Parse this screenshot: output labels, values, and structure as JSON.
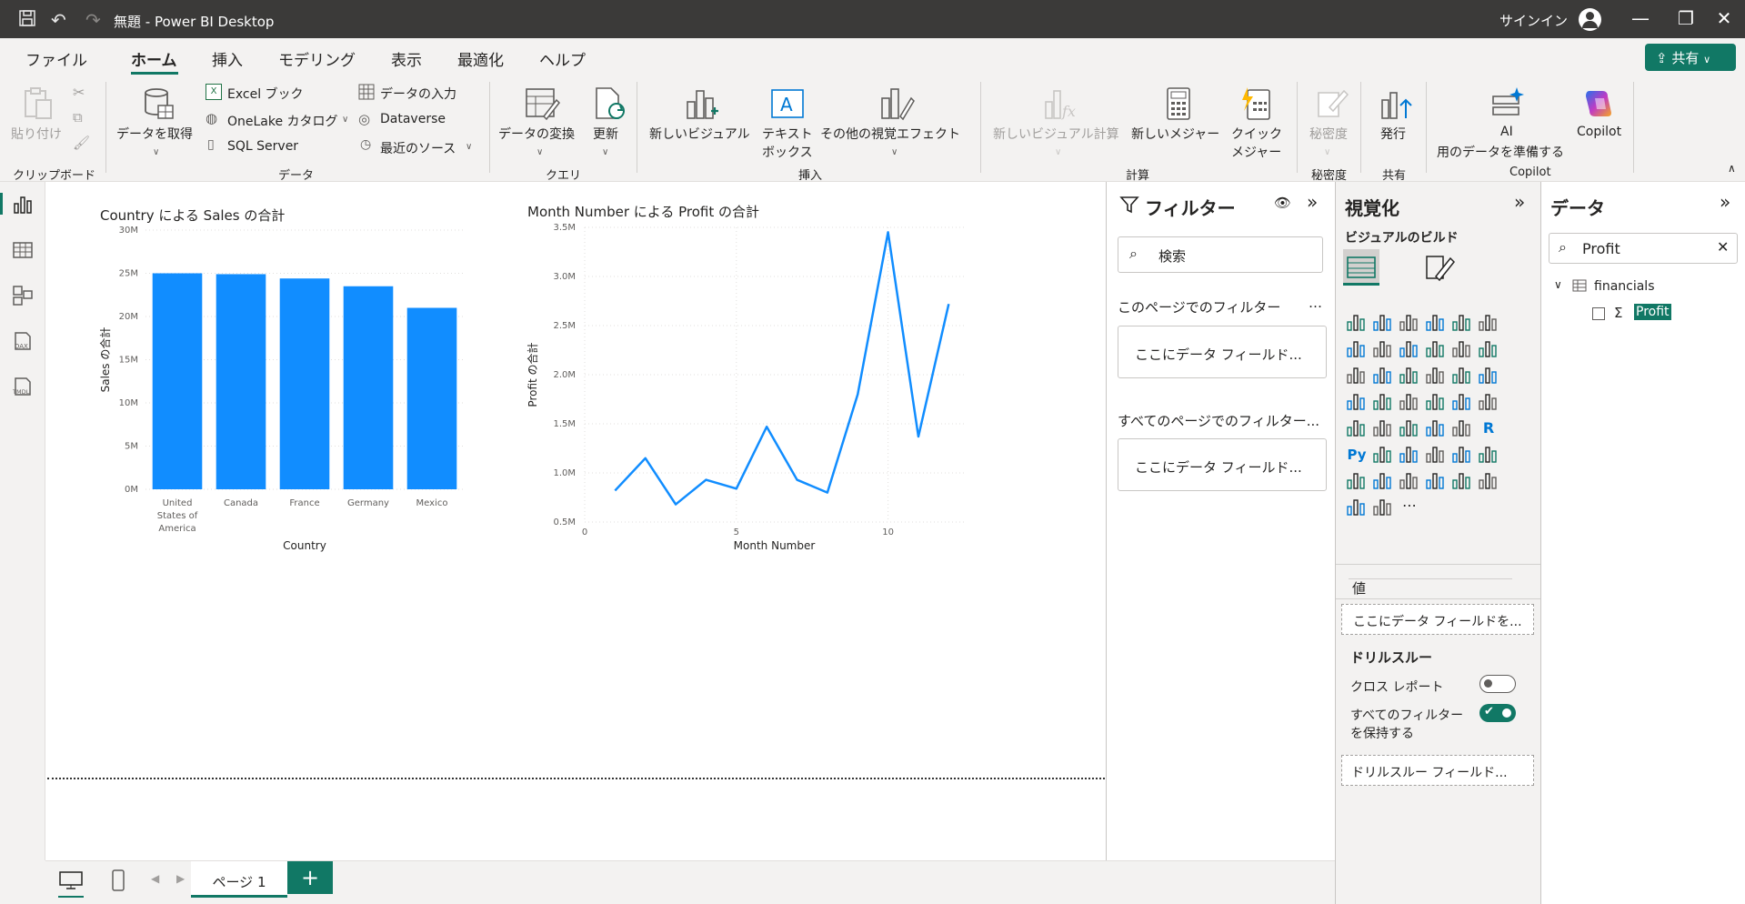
{
  "titlebar": {
    "title": "無題 - Power BI Desktop",
    "signin": "サインイン"
  },
  "menu": {
    "items": [
      "ファイル",
      "ホーム",
      "挿入",
      "モデリング",
      "表示",
      "最適化",
      "ヘルプ"
    ],
    "share": "共有"
  },
  "ribbon": {
    "clipboard": {
      "paste": "貼り付け",
      "group": "クリップボード"
    },
    "data": {
      "get_data": "データを取得",
      "excel": "Excel ブック",
      "onelake": "OneLake カタログ",
      "sql": "SQL Server",
      "enter_data": "データの入力",
      "dataverse": "Dataverse",
      "recent": "最近のソース",
      "group": "データ"
    },
    "query": {
      "transform": "データの変換",
      "refresh": "更新",
      "group": "クエリ"
    },
    "insert": {
      "new_visual": "新しいビジュアル",
      "textbox_1": "テキスト",
      "textbox_2": "ボックス",
      "more_visuals": "その他の視覚エフェクト",
      "group": "挿入"
    },
    "calc": {
      "new_visual_calc": "新しいビジュアル計算",
      "new_measure": "新しいメジャー",
      "quick_measure_1": "クイック",
      "quick_measure_2": "メジャー",
      "group": "計算"
    },
    "sensitivity": {
      "label": "秘密度",
      "group": "秘密度"
    },
    "share": {
      "publish": "発行",
      "group": "共有"
    },
    "copilot": {
      "ai_prep_1": "AI",
      "ai_prep_2": "用のデータを準備する",
      "copilot": "Copilot",
      "group": "Copilot"
    }
  },
  "charts": {
    "bar_title": "Country による Sales の合計",
    "line_title": "Month Number による Profit の合計"
  },
  "chart_data": [
    {
      "type": "bar",
      "title": "Country による Sales の合計",
      "categories": [
        "United States of America",
        "Canada",
        "France",
        "Germany",
        "Mexico"
      ],
      "category_lines": [
        [
          "United",
          "States of",
          "America"
        ],
        [
          "Canada"
        ],
        [
          "France"
        ],
        [
          "Germany"
        ],
        [
          "Mexico"
        ]
      ],
      "values": [
        25.0,
        24.9,
        24.4,
        23.5,
        21.0
      ],
      "xlabel": "Country",
      "ylabel": "Sales の合計",
      "ylim": [
        0,
        30
      ],
      "yticks": [
        "0M",
        "5M",
        "10M",
        "15M",
        "20M",
        "25M",
        "30M"
      ],
      "color": "#118DFF",
      "grid": true
    },
    {
      "type": "line",
      "title": "Month Number による Profit の合計",
      "x": [
        1,
        2,
        3,
        4,
        5,
        6,
        7,
        8,
        9,
        10,
        11,
        12
      ],
      "y": [
        0.82,
        1.15,
        0.68,
        0.93,
        0.84,
        1.47,
        0.93,
        0.8,
        1.8,
        3.45,
        1.37,
        2.72
      ],
      "xlabel": "Month Number",
      "ylabel": "Profit の合計",
      "xlim": [
        0,
        12.5
      ],
      "ylim": [
        0.5,
        3.5
      ],
      "xticks": [
        "0",
        "5",
        "10"
      ],
      "yticks": [
        "0.5M",
        "1.0M",
        "1.5M",
        "2.0M",
        "2.5M",
        "3.0M",
        "3.5M"
      ],
      "color": "#118DFF",
      "grid": true
    }
  ],
  "filters": {
    "title": "フィルター",
    "search_placeholder": "検索",
    "this_page": "このページでのフィルター",
    "all_pages": "すべてのページでのフィルター...",
    "drop_here": "ここにデータ フィールド..."
  },
  "viz": {
    "title": "視覚化",
    "build": "ビジュアルのビルド",
    "values_label": "値",
    "values_drop": "ここにデータ フィールドを...",
    "drillthrough": "ドリルスルー",
    "cross_report": "クロス レポート",
    "keep_filters_1": "すべてのフィルター",
    "keep_filters_2": "を保持する",
    "drill_drop": "ドリルスルー フィールド..."
  },
  "data_pane": {
    "title": "データ",
    "search_value": "Profit",
    "table": "financials",
    "field": "Profit"
  },
  "pages": {
    "page1": "ページ 1",
    "add": "+"
  }
}
